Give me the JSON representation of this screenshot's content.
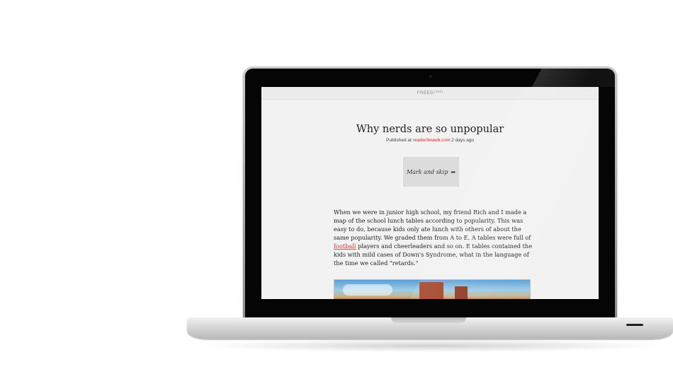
{
  "app": {
    "name": "FREED",
    "badge": "(100)"
  },
  "post": {
    "title": "Why nerds are so unpopular",
    "published_prefix": "Published at",
    "source": "readwriteweb.com",
    "age": "2 days ago"
  },
  "actions": {
    "mark_skip_label": "Mark and skip",
    "mark_skip_icon": "arrow-right-icon"
  },
  "article": {
    "text_before_link": "When we were in junior high school, my friend Rich and I made a map of the school lunch tables according to popularity. This was easy to do, because kids only ate lunch with others of about the same popularity. We graded them from A to E. A tables were full of ",
    "link_text": "football",
    "text_after_link": " players and cheerleaders and so on. E tables contained the kids with mild cases of Down's Syndrome, what in the language of the time we called \"retards.\""
  },
  "colors": {
    "link": "#d93a3a",
    "source": "#e02a2a",
    "screen_bg": "#f2f2f2",
    "button_bg": "#dcdcdc"
  }
}
